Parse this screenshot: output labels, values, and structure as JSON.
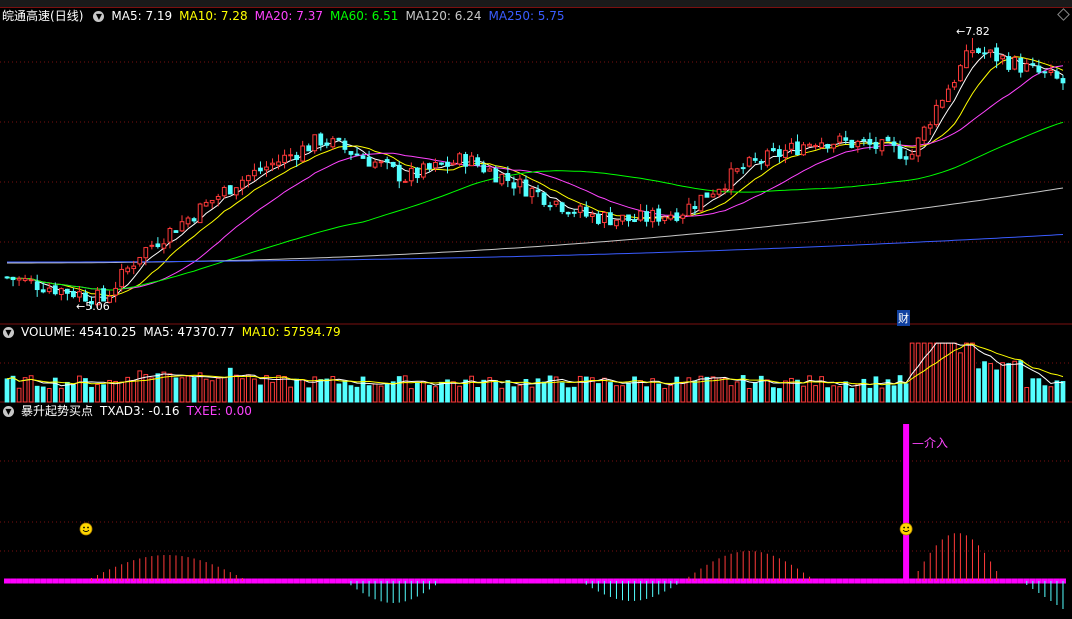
{
  "header": {
    "stock_name": "皖通高速",
    "period": "(日线)",
    "ma": [
      {
        "label": "MA5: 7.19",
        "color": "#ffffff"
      },
      {
        "label": "MA10: 7.28",
        "color": "#ffff00"
      },
      {
        "label": "MA20: 7.37",
        "color": "#ff44ff"
      },
      {
        "label": "MA60: 6.51",
        "color": "#00ff00"
      },
      {
        "label": "MA120: 6.24",
        "color": "#c8c8c8"
      },
      {
        "label": "MA250: 5.75",
        "color": "#3a5cff"
      }
    ]
  },
  "volume_header": {
    "label": "VOLUME: 45410.25",
    "ma5": "MA5: 47370.77",
    "ma10": "MA10: 57594.79"
  },
  "indicator_header": {
    "name": "暴升起势买点",
    "txad3": "TXAD3: -0.16",
    "txee": "TXEE: 0.00"
  },
  "annotations": {
    "low_price": "5.06",
    "high_price": "7.82",
    "fin_marker": "财",
    "entry_label": "介入"
  },
  "colors": {
    "up": "#ff3a3a",
    "down": "#54ffff",
    "grid": "#7a1010",
    "signal": "#ff00ff"
  },
  "chart_data": {
    "type": "candlestick",
    "price_low": 5.06,
    "price_high": 7.82,
    "ma_current": {
      "MA5": 7.19,
      "MA10": 7.28,
      "MA20": 7.37,
      "MA60": 6.51,
      "MA120": 6.24,
      "MA250": 5.75
    },
    "volume_current": 45410.25,
    "volume_ma5": 47370.77,
    "volume_ma10": 57594.79,
    "txad3": -0.16,
    "txee": 0.0
  }
}
